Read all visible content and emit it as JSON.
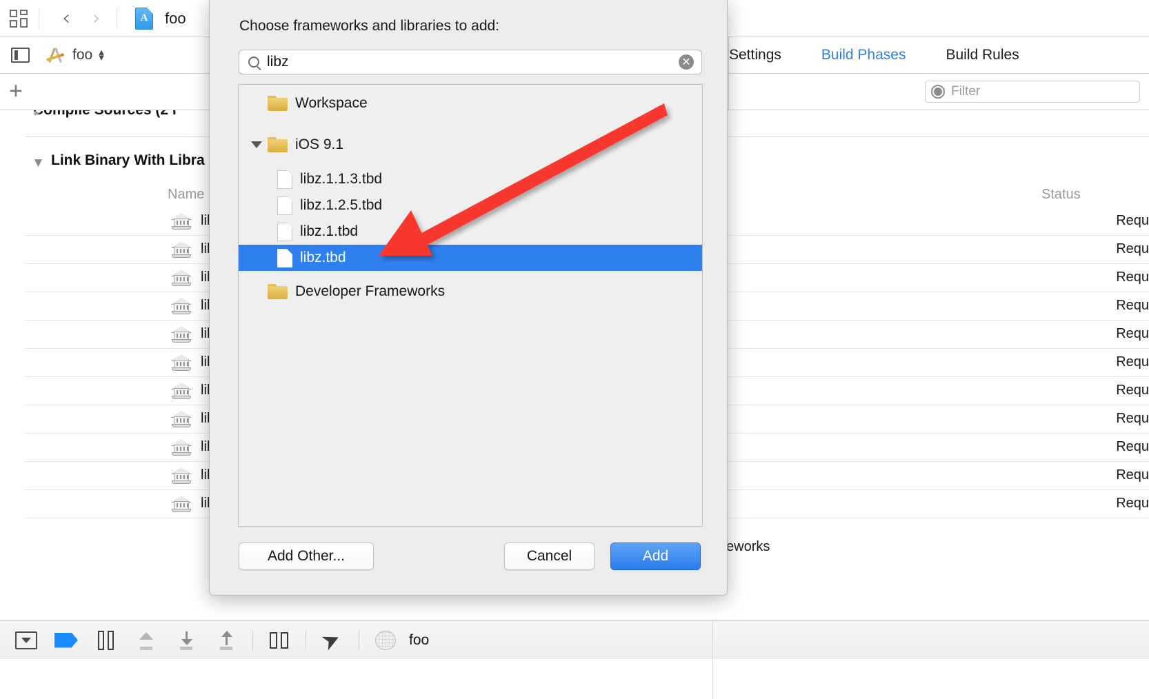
{
  "window": {
    "toolbar": {
      "grid_icon": "grid-view-icon",
      "back_label": "‹",
      "forward_label": "›",
      "project_icon": "app-document-icon",
      "project_name": "foo",
      "app_glyph": "A"
    },
    "jumpbar": {
      "panel_toggle_icon": "navigator-toggle-icon",
      "scheme_icon": "scheme-icon",
      "scheme_name": "foo",
      "stepper_up": "▴",
      "stepper_down": "▾"
    },
    "addbar": {
      "plus_label": "+"
    }
  },
  "editor_tabs": [
    {
      "label": "Settings",
      "active": false
    },
    {
      "label": "Build Phases",
      "active": true
    },
    {
      "label": "Build Rules",
      "active": false
    }
  ],
  "filter": {
    "icon": "filter-icon",
    "placeholder": "Filter"
  },
  "build_phases": {
    "collapsed_phase_label": "Compile Sources (2 i",
    "phase_label": "Link Binary With Libra",
    "disclosure_glyph": "▼",
    "columns": {
      "name": "Name",
      "status": "Status"
    },
    "rows": [
      {
        "name": "lib",
        "status": "Requ"
      },
      {
        "name": "lib",
        "status": "Requ"
      },
      {
        "name": "lib",
        "status": "Requ"
      },
      {
        "name": "lib",
        "status": "Requ"
      },
      {
        "name": "lib",
        "status": "Requ"
      },
      {
        "name": "lib",
        "status": "Requ"
      },
      {
        "name": "lib",
        "status": "Requ"
      },
      {
        "name": "lib",
        "status": "Requ"
      },
      {
        "name": "lib",
        "status": "Requ"
      },
      {
        "name": "lib",
        "status": "Requ"
      },
      {
        "name": "lib",
        "status": "Requ"
      }
    ],
    "add_button_label": "+",
    "footer_cut_text": "eworks"
  },
  "debug_bar": {
    "icons": [
      "hide-debug-area-icon",
      "breakpoints-icon",
      "pause-icon",
      "step-over-icon",
      "step-into-icon",
      "step-out-icon",
      "view-hierarchy-icon",
      "simulate-location-icon",
      "process-icon"
    ],
    "process_label": "foo"
  },
  "sheet": {
    "title": "Choose frameworks and libraries to add:",
    "search": {
      "icon": "search-icon",
      "value": "libz",
      "placeholder": "",
      "clear_icon": "clear-icon",
      "clear_glyph": "✕"
    },
    "tree": [
      {
        "label": "Workspace",
        "type": "folder",
        "indent": 0,
        "expandable": false,
        "expanded": false,
        "selected": false
      },
      {
        "label": "iOS 9.1",
        "type": "folder",
        "indent": 0,
        "expandable": true,
        "expanded": true,
        "selected": false
      },
      {
        "label": "libz.1.1.3.tbd",
        "type": "file",
        "indent": 1,
        "expandable": false,
        "expanded": false,
        "selected": false
      },
      {
        "label": "libz.1.2.5.tbd",
        "type": "file",
        "indent": 1,
        "expandable": false,
        "expanded": false,
        "selected": false
      },
      {
        "label": "libz.1.tbd",
        "type": "file",
        "indent": 1,
        "expandable": false,
        "expanded": false,
        "selected": false
      },
      {
        "label": "libz.tbd",
        "type": "file",
        "indent": 1,
        "expandable": false,
        "expanded": false,
        "selected": true
      },
      {
        "label": "Developer Frameworks",
        "type": "folder",
        "indent": 0,
        "expandable": false,
        "expanded": false,
        "selected": false
      }
    ],
    "buttons": {
      "add_other": "Add Other...",
      "cancel": "Cancel",
      "add": "Add"
    }
  },
  "annotation": {
    "arrow_color": "#F8372E",
    "arrow_name": "red-pointer-arrow",
    "points_at": "libz.tbd"
  },
  "colors": {
    "accent_blue": "#2F7FEF",
    "selection_blue": "#2F7FEF",
    "tab_active": "#2F7FE0",
    "sheet_bg": "#ECECEC",
    "list_bg": "#EFEFEF",
    "folder_yellow": "#E3BB52",
    "arrow_red": "#F8372E"
  }
}
